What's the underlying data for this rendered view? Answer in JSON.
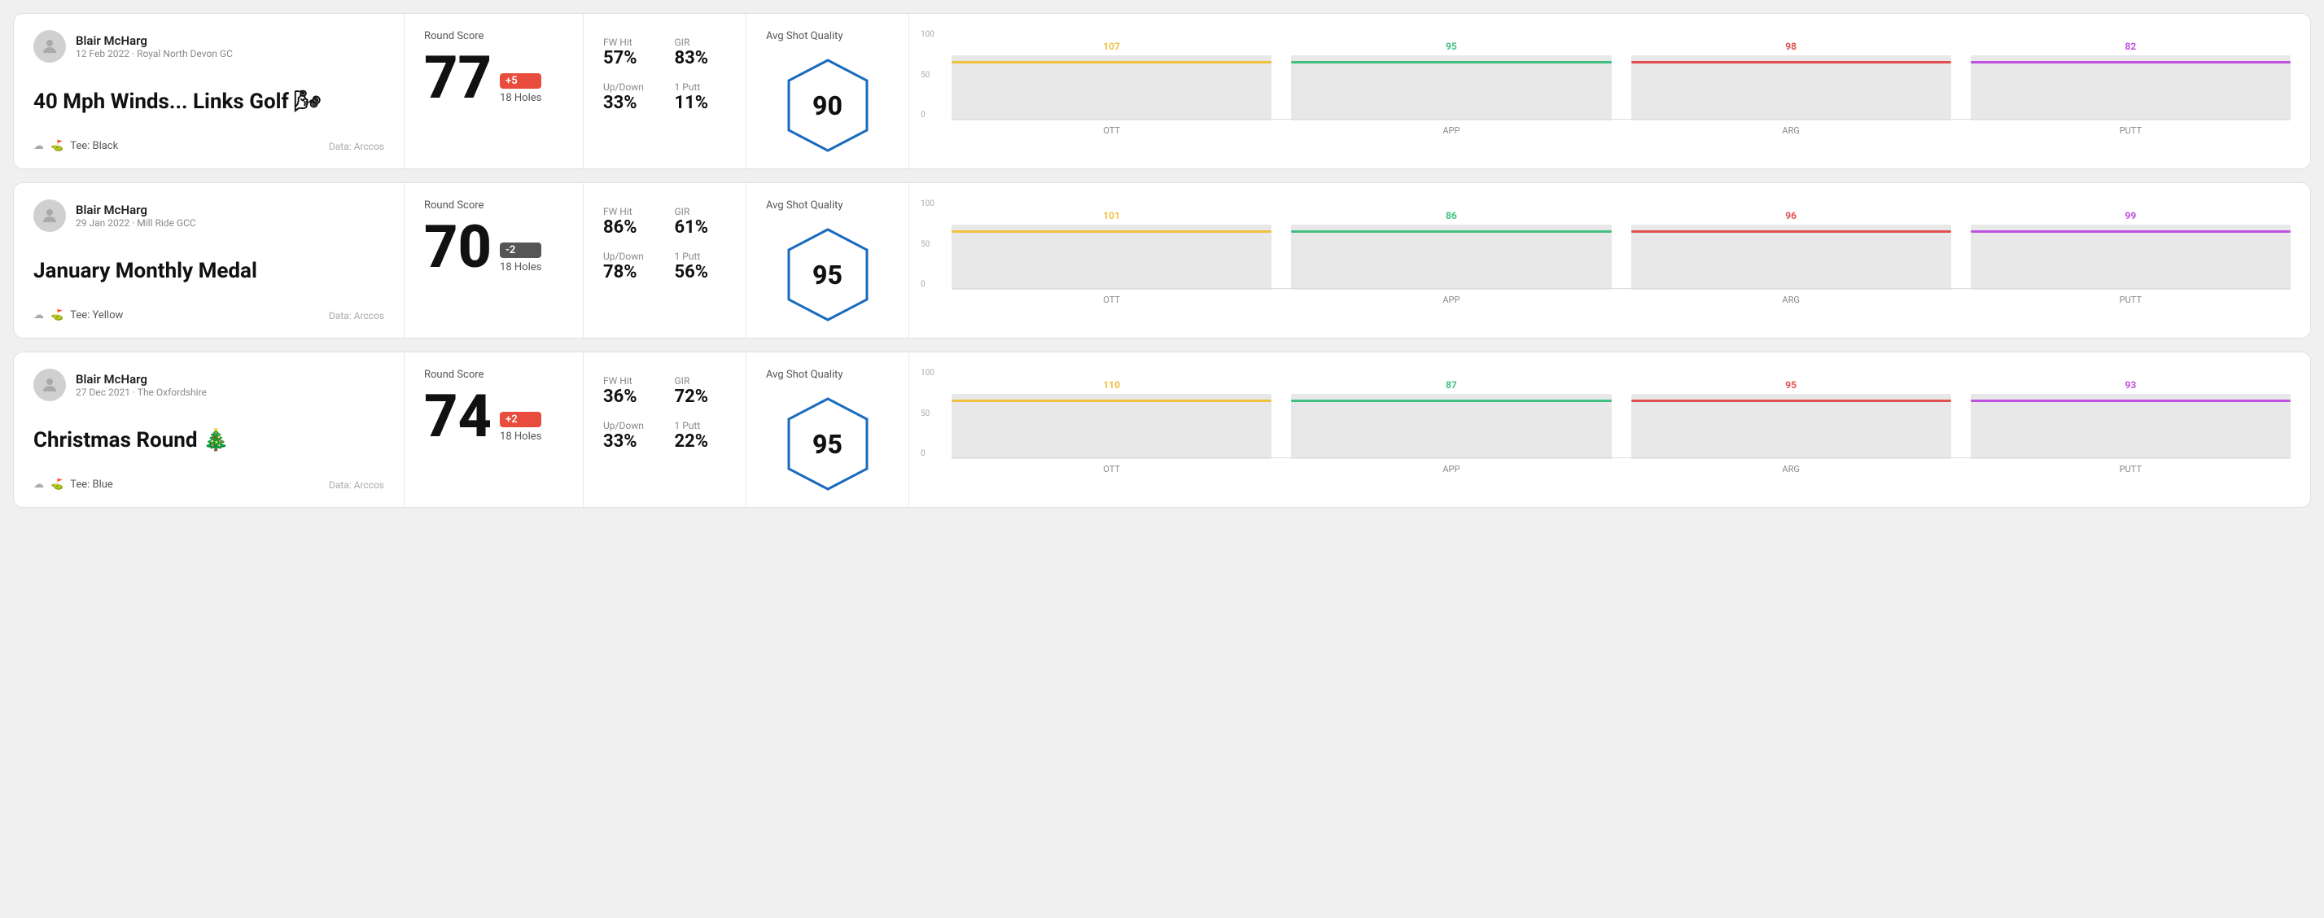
{
  "rounds": [
    {
      "id": "round1",
      "user": {
        "name": "Blair McHarg",
        "date": "12 Feb 2022 · Royal North Devon GC"
      },
      "title": "40 Mph Winds... Links Golf",
      "title_emoji": "🌬",
      "tee": "Black",
      "data_source": "Data: Arccos",
      "score": {
        "label": "Round Score",
        "value": "77",
        "badge": "+5",
        "badge_type": "positive",
        "holes": "18 Holes"
      },
      "stats": {
        "fw_hit": {
          "label": "FW Hit",
          "value": "57%"
        },
        "gir": {
          "label": "GIR",
          "value": "83%"
        },
        "up_down": {
          "label": "Up/Down",
          "value": "33%"
        },
        "one_putt": {
          "label": "1 Putt",
          "value": "11%"
        }
      },
      "quality": {
        "label": "Avg Shot Quality",
        "score": "90"
      },
      "chart": {
        "bars": [
          {
            "label": "OTT",
            "value": 107,
            "color": "#f0c040",
            "max": 100
          },
          {
            "label": "APP",
            "value": 95,
            "color": "#40c080",
            "max": 100
          },
          {
            "label": "ARG",
            "value": 98,
            "color": "#e05050",
            "max": 100
          },
          {
            "label": "PUTT",
            "value": 82,
            "color": "#c050e0",
            "max": 100
          }
        ],
        "y_labels": [
          "100",
          "50",
          "0"
        ]
      }
    },
    {
      "id": "round2",
      "user": {
        "name": "Blair McHarg",
        "date": "29 Jan 2022 · Mill Ride GCC"
      },
      "title": "January Monthly Medal",
      "title_emoji": "",
      "tee": "Yellow",
      "data_source": "Data: Arccos",
      "score": {
        "label": "Round Score",
        "value": "70",
        "badge": "-2",
        "badge_type": "negative",
        "holes": "18 Holes"
      },
      "stats": {
        "fw_hit": {
          "label": "FW Hit",
          "value": "86%"
        },
        "gir": {
          "label": "GIR",
          "value": "61%"
        },
        "up_down": {
          "label": "Up/Down",
          "value": "78%"
        },
        "one_putt": {
          "label": "1 Putt",
          "value": "56%"
        }
      },
      "quality": {
        "label": "Avg Shot Quality",
        "score": "95"
      },
      "chart": {
        "bars": [
          {
            "label": "OTT",
            "value": 101,
            "color": "#f0c040",
            "max": 100
          },
          {
            "label": "APP",
            "value": 86,
            "color": "#40c080",
            "max": 100
          },
          {
            "label": "ARG",
            "value": 96,
            "color": "#e05050",
            "max": 100
          },
          {
            "label": "PUTT",
            "value": 99,
            "color": "#c050e0",
            "max": 100
          }
        ],
        "y_labels": [
          "100",
          "50",
          "0"
        ]
      }
    },
    {
      "id": "round3",
      "user": {
        "name": "Blair McHarg",
        "date": "27 Dec 2021 · The Oxfordshire"
      },
      "title": "Christmas Round",
      "title_emoji": "🎄",
      "tee": "Blue",
      "data_source": "Data: Arccos",
      "score": {
        "label": "Round Score",
        "value": "74",
        "badge": "+2",
        "badge_type": "positive",
        "holes": "18 Holes"
      },
      "stats": {
        "fw_hit": {
          "label": "FW Hit",
          "value": "36%"
        },
        "gir": {
          "label": "GIR",
          "value": "72%"
        },
        "up_down": {
          "label": "Up/Down",
          "value": "33%"
        },
        "one_putt": {
          "label": "1 Putt",
          "value": "22%"
        }
      },
      "quality": {
        "label": "Avg Shot Quality",
        "score": "95"
      },
      "chart": {
        "bars": [
          {
            "label": "OTT",
            "value": 110,
            "color": "#f0c040",
            "max": 100
          },
          {
            "label": "APP",
            "value": 87,
            "color": "#40c080",
            "max": 100
          },
          {
            "label": "ARG",
            "value": 95,
            "color": "#e05050",
            "max": 100
          },
          {
            "label": "PUTT",
            "value": 93,
            "color": "#c050e0",
            "max": 100
          }
        ],
        "y_labels": [
          "100",
          "50",
          "0"
        ]
      }
    }
  ]
}
